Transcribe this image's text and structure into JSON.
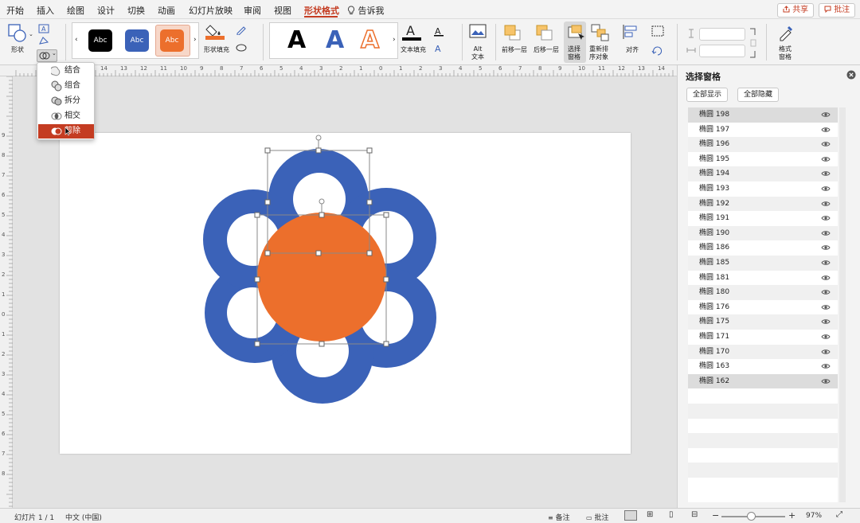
{
  "menu": {
    "tabs": [
      "开始",
      "插入",
      "绘图",
      "设计",
      "切换",
      "动画",
      "幻灯片放映",
      "审阅",
      "视图",
      "形状格式"
    ],
    "tell_me": "告诉我",
    "share": "共享",
    "comments": "批注"
  },
  "ribbon": {
    "shapes_label": "形状",
    "style_swatches": [
      {
        "text": "Abc",
        "color": "#000000"
      },
      {
        "text": "Abc",
        "color": "#3b62b8"
      },
      {
        "text": "Abc",
        "color": "#ec6f2c"
      }
    ],
    "shape_fill_label": "形状填充",
    "wordart": [
      "A",
      "A",
      "A"
    ],
    "text_fill_label": "文本填充",
    "alt_text_label": "Alt\n文本",
    "bring_forward_label": "前移一层",
    "send_backward_label": "后移一层",
    "selection_pane_label": "选择\n窗格",
    "reorder_label": "重新排\n序对象",
    "align_label": "对齐",
    "format_pane_label": "格式\n窗格"
  },
  "ruler_numbers": [
    "14",
    "13",
    "12",
    "11",
    "10",
    "9",
    "8",
    "7",
    "6",
    "5",
    "4",
    "3",
    "2",
    "1",
    "0",
    "1",
    "2",
    "3",
    "4",
    "5",
    "6",
    "7",
    "8",
    "9",
    "10",
    "11",
    "12",
    "13",
    "14"
  ],
  "vruler_numbers": [
    "9",
    "8",
    "7",
    "6",
    "5",
    "4",
    "3",
    "2",
    "1",
    "0",
    "1",
    "2",
    "3",
    "4",
    "5",
    "6",
    "7",
    "8"
  ],
  "merge_menu": {
    "items": [
      {
        "label": "结合",
        "selected": false
      },
      {
        "label": "组合",
        "selected": false
      },
      {
        "label": "拆分",
        "selected": false
      },
      {
        "label": "相交",
        "selected": false
      },
      {
        "label": "剪除",
        "selected": true
      }
    ]
  },
  "selection_pane": {
    "title": "选择窗格",
    "show_all": "全部显示",
    "hide_all": "全部隐藏",
    "items": [
      "椭圆 198",
      "椭圆 197",
      "椭圆 196",
      "椭圆 195",
      "椭圆 194",
      "椭圆 193",
      "椭圆 192",
      "椭圆 191",
      "椭圆 190",
      "椭圆 186",
      "椭圆 185",
      "椭圆 181",
      "椭圆 180",
      "椭圆 176",
      "椭圆 175",
      "椭圆 171",
      "椭圆 170",
      "椭圆 163",
      "椭圆 162"
    ]
  },
  "slide": {
    "flower_color": "#3b62b8",
    "center_color": "#ec6f2c"
  },
  "status": {
    "slide_count": "幻灯片 1 / 1",
    "language": "中文 (中国)",
    "notes": "备注",
    "comments": "批注",
    "zoom": "97%"
  }
}
